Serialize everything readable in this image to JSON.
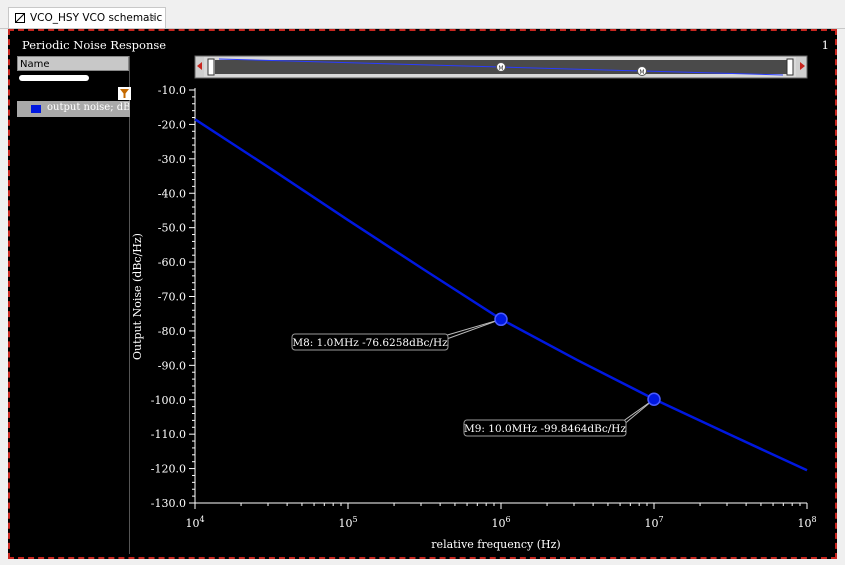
{
  "tab": {
    "title": "VCO_HSY VCO schematic",
    "close": "×"
  },
  "window": {
    "title": "Periodic Noise Response",
    "index": "1"
  },
  "legend_panel": {
    "header": "Name",
    "items": [
      {
        "label": "output noise; dBc",
        "color": "#0018e0"
      }
    ]
  },
  "markers": [
    {
      "id": "M8",
      "label": "M8: 1.0MHz -76.6258dBc/Hz",
      "x": 1000000,
      "y": -76.6258,
      "icon": "M"
    },
    {
      "id": "M9",
      "label": "M9: 10.0MHz -99.8464dBc/Hz",
      "x": 10000000,
      "y": -99.8464,
      "icon": "M"
    }
  ],
  "chart_data": {
    "type": "line",
    "xscale": "log",
    "xlim": [
      10000,
      100000000
    ],
    "ylim": [
      -130,
      -10
    ],
    "xlabel": "relative frequency (Hz)",
    "ylabel": "Output Noise (dBc/Hz)",
    "x_ticks": [
      10000,
      100000,
      1000000,
      10000000,
      100000000
    ],
    "x_tick_labels": [
      {
        "base": "10",
        "exp": "4"
      },
      {
        "base": "10",
        "exp": "5"
      },
      {
        "base": "10",
        "exp": "6"
      },
      {
        "base": "10",
        "exp": "7"
      },
      {
        "base": "10",
        "exp": "8"
      }
    ],
    "y_ticks": [
      -10,
      -20,
      -30,
      -40,
      -50,
      -60,
      -70,
      -80,
      -90,
      -100,
      -110,
      -120,
      -130
    ],
    "y_tick_labels": [
      "-10.0",
      "-20.0",
      "-30.0",
      "-40.0",
      "-50.0",
      "-60.0",
      "-70.0",
      "-80.0",
      "-90.0",
      "-100.0",
      "-110.0",
      "-120.0",
      "-130.0"
    ],
    "grid": false,
    "series": [
      {
        "name": "output noise; dBc",
        "color": "#0018e0",
        "x": [
          10000,
          31623,
          100000,
          316228,
          1000000,
          3162278,
          10000000,
          31622777,
          100000000
        ],
        "y": [
          -18.5,
          -33.0,
          -47.8,
          -62.3,
          -76.6,
          -88.5,
          -99.8,
          -110.2,
          -120.5
        ]
      }
    ]
  }
}
